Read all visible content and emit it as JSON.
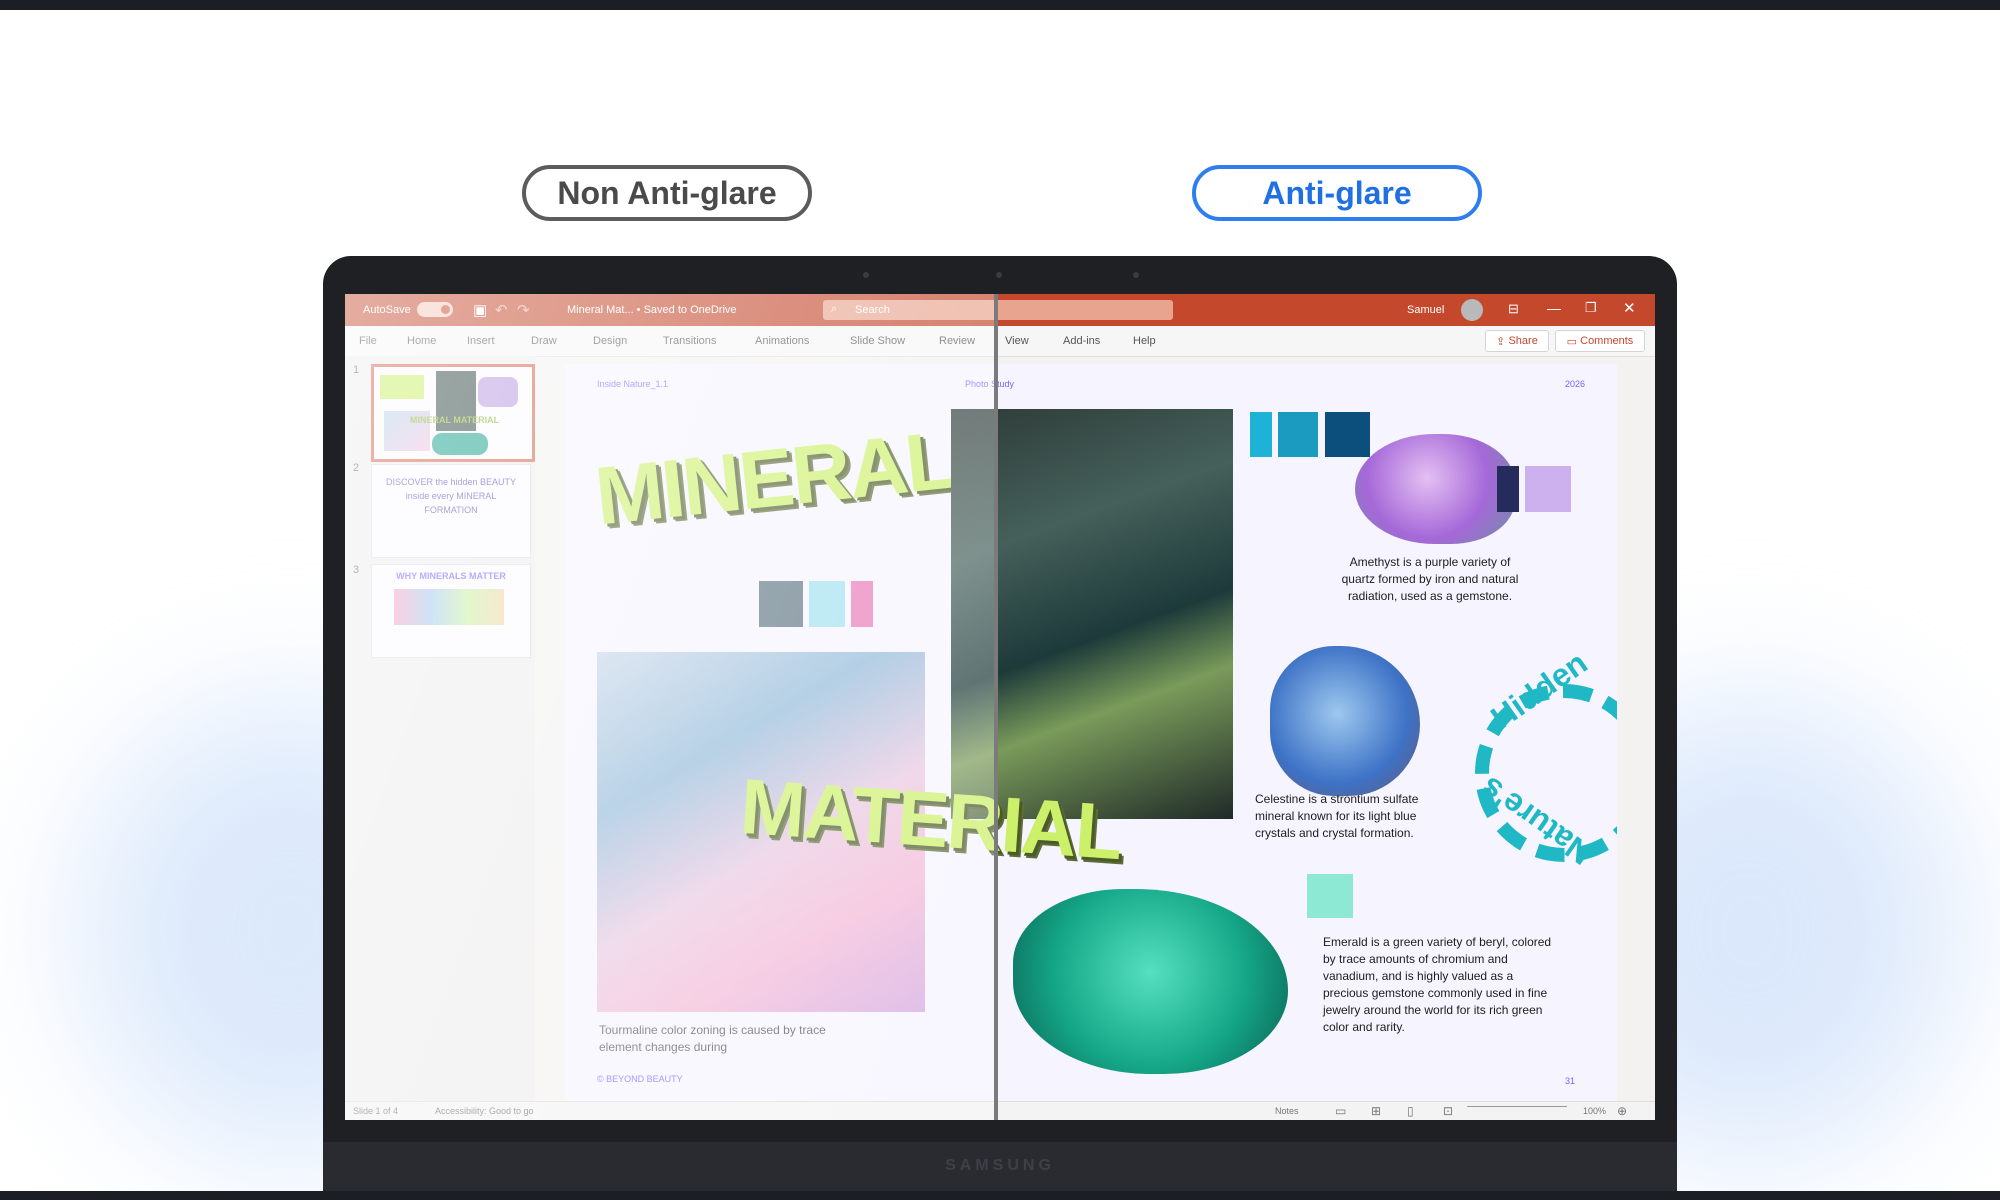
{
  "labels": {
    "non_antiglare": "Non Anti-glare",
    "antiglare": "Anti-glare"
  },
  "laptop": {
    "brand": "SAMSUNG"
  },
  "app": {
    "autosave": "AutoSave",
    "autosave_state": "On",
    "file_title": "Mineral Mat... • Saved to OneDrive",
    "search_placeholder": "Search",
    "user": "Samuel",
    "menu": [
      "File",
      "Home",
      "Insert",
      "Draw",
      "Design",
      "Transitions",
      "Animations",
      "Slide Show",
      "Review",
      "View",
      "Add-ins",
      "Help"
    ],
    "share": "Share",
    "comments": "Comments"
  },
  "thumbnails": [
    {
      "num": "1",
      "text": "MINERAL MATERIAL"
    },
    {
      "num": "2",
      "text": "DISCOVER the hidden BEAUTY inside every MINERAL FORMATION"
    },
    {
      "num": "3",
      "text": "WHY MINERALS MATTER"
    }
  ],
  "slide": {
    "header_left": "Inside Nature_1.1",
    "header_mid": "Photo Study",
    "header_right": "2026",
    "title1": "MINERAL",
    "title2": "MATERIAL",
    "tourmaline": "Tourmaline color zoning is caused by trace element changes during",
    "footer_left": "© BEYOND BEAUTY",
    "amethyst": "Amethyst is a purple variety of quartz formed by iron and natural radiation, used as a gemstone.",
    "celestine": "Celestine is a strontium sulfate mineral known for its light blue crystals and crystal formation.",
    "emerald": "Emerald is a green variety of beryl, colored by trace amounts of chromium and vanadium, and is highly valued as a precious gemstone commonly used in fine jewelry around the world for its rich green color and rarity.",
    "hidden_word": "Hidden",
    "natures_word": "Nature's",
    "page_number": "31"
  },
  "status": {
    "slide": "Slide 1 of 4",
    "accessibility": "Accessibility: Good to go",
    "notes": "Notes",
    "zoom": "100%"
  },
  "colors": {
    "titlebar": "#c4482c",
    "accent_blue": "#1f6fe5",
    "lime": "#ccf06a",
    "teal": "#1fb8c4"
  }
}
